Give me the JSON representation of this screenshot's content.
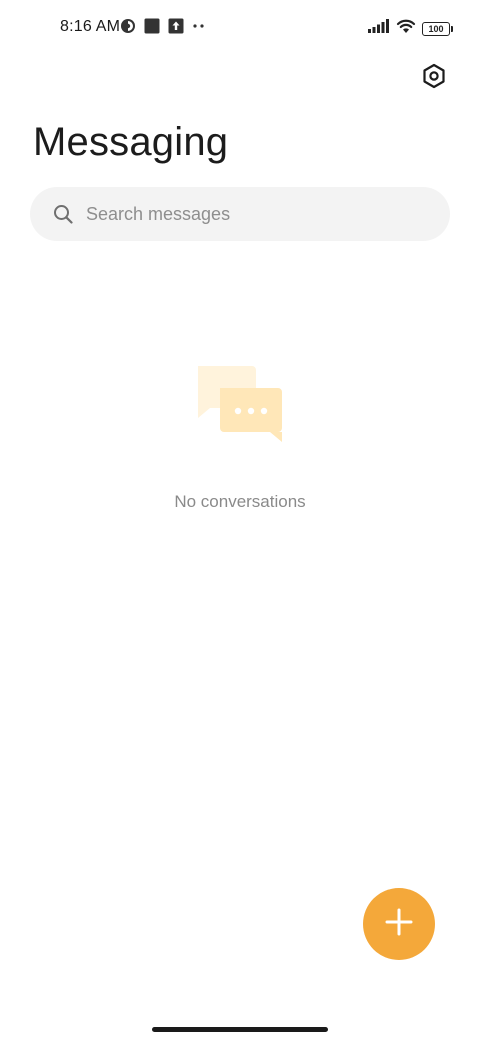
{
  "status_bar": {
    "time": "8:16 AM",
    "battery": "100",
    "left_icons": [
      "data-saver-icon",
      "square-notification-icon",
      "upload-notification-icon",
      "more-dots-icon"
    ],
    "right_icons": [
      "signal-icon",
      "wifi-icon",
      "battery-icon"
    ]
  },
  "header": {
    "title": "Messaging",
    "settings_icon": "settings-hex-icon"
  },
  "search": {
    "placeholder": "Search messages",
    "icon": "search-icon"
  },
  "empty_state": {
    "illustration": "chat-bubbles-icon",
    "text": "No conversations"
  },
  "fab": {
    "icon": "plus-icon"
  },
  "colors": {
    "accent": "#f4a83a",
    "background": "#ffffff",
    "search_bg": "#f3f3f3",
    "bubble_light": "#fff3dc",
    "bubble_dark": "#ffe7b8"
  }
}
